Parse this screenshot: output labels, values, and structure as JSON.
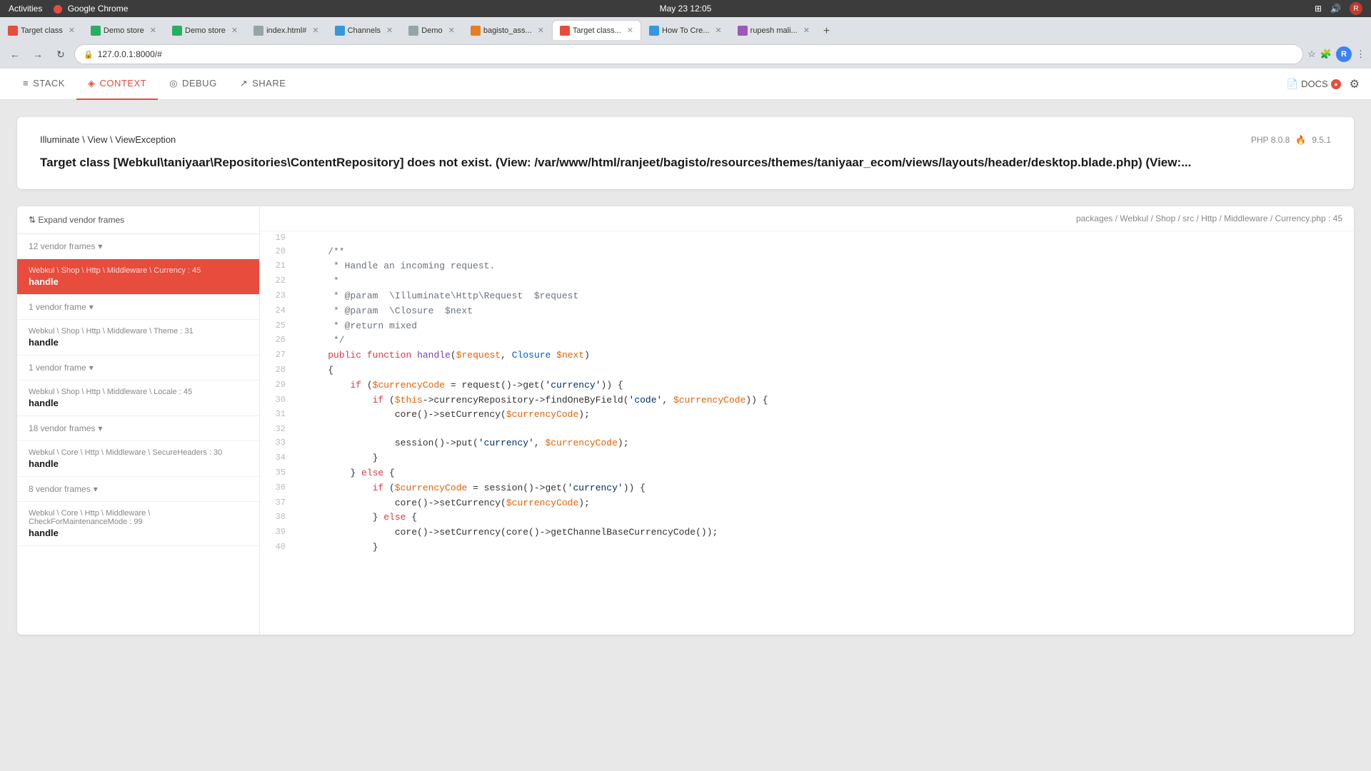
{
  "os": {
    "left_items": [
      "Activities",
      "Google Chrome"
    ],
    "datetime": "May 23  12:05"
  },
  "browser": {
    "url": "127.0.0.1:8000/#",
    "tabs": [
      {
        "label": "Target class",
        "active": false,
        "fav": "red"
      },
      {
        "label": "Demo store",
        "active": false,
        "fav": "green"
      },
      {
        "label": "Demo store",
        "active": false,
        "fav": "green"
      },
      {
        "label": "index.html#",
        "active": false,
        "fav": "gray"
      },
      {
        "label": "Channels",
        "active": false,
        "fav": "blue"
      },
      {
        "label": "Demo",
        "active": false,
        "fav": "gray"
      },
      {
        "label": "bagisto_ass...",
        "active": false,
        "fav": "orange"
      },
      {
        "label": "Target class...",
        "active": true,
        "fav": "red"
      },
      {
        "label": "How To Cre...",
        "active": false,
        "fav": "blue"
      },
      {
        "label": "rupesh mali...",
        "active": false,
        "fav": "purple"
      }
    ]
  },
  "ignition": {
    "nav_items": [
      {
        "label": "STACK",
        "active": false,
        "icon": "≡"
      },
      {
        "label": "CONTEXT",
        "active": true,
        "icon": "◈"
      },
      {
        "label": "DEBUG",
        "active": false,
        "icon": "◎"
      },
      {
        "label": "SHARE",
        "active": false,
        "icon": "↗"
      }
    ],
    "docs_label": "DOCS",
    "docs_count": "●",
    "gear_icon": "⚙"
  },
  "error": {
    "exception": "Illuminate \\ View \\ ViewException",
    "php_version": "PHP 8.0.8",
    "ignition_version": "9.5.1",
    "message": "Target class [Webkul\\taniyaar\\Repositories\\ContentRepository] does not exist. (View: /var/www/html/ranjeet/bagisto/resources/themes/taniyaar_ecom/views/layouts/header/desktop.blade.php) (View:..."
  },
  "stack": {
    "expand_btn": "⇅ Expand vendor frames",
    "frames": [
      {
        "type": "vendor-count",
        "label": "12 vendor frames",
        "has_toggle": true
      },
      {
        "type": "frame",
        "active": true,
        "path": "Webkul \\ Shop \\ Http \\ Middleware \\ Currency : 45",
        "method": "handle"
      },
      {
        "type": "vendor-count",
        "label": "1 vendor frame",
        "has_toggle": true
      },
      {
        "type": "frame",
        "active": false,
        "path": "Webkul \\ Shop \\ Http \\ Middleware \\ Theme : 31",
        "method": "handle"
      },
      {
        "type": "vendor-count",
        "label": "1 vendor frame",
        "has_toggle": true
      },
      {
        "type": "frame",
        "active": false,
        "path": "Webkul \\ Shop \\ Http \\ Middleware \\ Locale : 45",
        "method": "handle"
      },
      {
        "type": "vendor-count",
        "label": "18 vendor frames",
        "has_toggle": true
      },
      {
        "type": "frame",
        "active": false,
        "path": "Webkul \\ Core \\ Http \\ Middleware \\ SecureHeaders : 30",
        "method": "handle"
      },
      {
        "type": "vendor-count",
        "label": "8 vendor frames",
        "has_toggle": true
      },
      {
        "type": "frame",
        "active": false,
        "path": "Webkul \\ Core \\ Http \\ Middleware \\ CheckForMaintenanceMode : 99",
        "method": "handle"
      }
    ]
  },
  "code": {
    "file_path": "packages / Webkul / Shop / src / Http / Middleware / Currency.php : 45",
    "lines": [
      {
        "num": 19,
        "tokens": []
      },
      {
        "num": 20,
        "tokens": [
          {
            "t": "comment",
            "v": "    /**"
          }
        ]
      },
      {
        "num": 21,
        "tokens": [
          {
            "t": "comment",
            "v": "     * Handle an incoming request."
          }
        ]
      },
      {
        "num": 22,
        "tokens": [
          {
            "t": "comment",
            "v": "     *"
          }
        ]
      },
      {
        "num": 23,
        "tokens": [
          {
            "t": "comment",
            "v": "     * @param  \\Illuminate\\Http\\Request  $request"
          }
        ]
      },
      {
        "num": 24,
        "tokens": [
          {
            "t": "comment",
            "v": "     * @param  \\Closure  $next"
          }
        ]
      },
      {
        "num": 25,
        "tokens": [
          {
            "t": "comment",
            "v": "     * @return mixed"
          }
        ]
      },
      {
        "num": 26,
        "tokens": [
          {
            "t": "comment",
            "v": "     */"
          }
        ]
      },
      {
        "num": 27,
        "tokens": [
          {
            "t": "kw",
            "v": "    public"
          },
          {
            "t": "plain",
            "v": " "
          },
          {
            "t": "kw",
            "v": "function"
          },
          {
            "t": "plain",
            "v": " "
          },
          {
            "t": "fn",
            "v": "handle"
          },
          {
            "t": "plain",
            "v": "("
          },
          {
            "t": "var",
            "v": "$request"
          },
          {
            "t": "plain",
            "v": ", "
          },
          {
            "t": "cls",
            "v": "Closure"
          },
          {
            "t": "plain",
            "v": " "
          },
          {
            "t": "var",
            "v": "$next"
          },
          {
            "t": "plain",
            "v": ")"
          }
        ]
      },
      {
        "num": 28,
        "tokens": [
          {
            "t": "plain",
            "v": "    {"
          }
        ]
      },
      {
        "num": 29,
        "tokens": [
          {
            "t": "plain",
            "v": "        "
          },
          {
            "t": "kw",
            "v": "if"
          },
          {
            "t": "plain",
            "v": " ("
          },
          {
            "t": "var",
            "v": "$currencyCode"
          },
          {
            "t": "plain",
            "v": " = request()->get("
          },
          {
            "t": "str",
            "v": "'currency'"
          },
          {
            "t": "plain",
            "v": ")) {"
          }
        ]
      },
      {
        "num": 30,
        "tokens": [
          {
            "t": "plain",
            "v": "            "
          },
          {
            "t": "kw",
            "v": "if"
          },
          {
            "t": "plain",
            "v": " ("
          },
          {
            "t": "var",
            "v": "$this"
          },
          {
            "t": "plain",
            "v": "->currencyRepository->findOneByField("
          },
          {
            "t": "str",
            "v": "'code'"
          },
          {
            "t": "plain",
            "v": ", "
          },
          {
            "t": "var",
            "v": "$currencyCode"
          },
          {
            "t": "plain",
            "v": ")) {"
          }
        ]
      },
      {
        "num": 31,
        "tokens": [
          {
            "t": "plain",
            "v": "                core()->setCurrency("
          },
          {
            "t": "var",
            "v": "$currencyCode"
          },
          {
            "t": "plain",
            "v": ");"
          }
        ]
      },
      {
        "num": 32,
        "tokens": []
      },
      {
        "num": 33,
        "tokens": [
          {
            "t": "plain",
            "v": "                session()->put("
          },
          {
            "t": "str",
            "v": "'currency'"
          },
          {
            "t": "plain",
            "v": ", "
          },
          {
            "t": "var",
            "v": "$currencyCode"
          },
          {
            "t": "plain",
            "v": ");"
          }
        ]
      },
      {
        "num": 34,
        "tokens": [
          {
            "t": "plain",
            "v": "            }"
          }
        ]
      },
      {
        "num": 35,
        "tokens": [
          {
            "t": "plain",
            "v": "        } "
          },
          {
            "t": "kw",
            "v": "else"
          },
          {
            "t": "plain",
            "v": " {"
          }
        ]
      },
      {
        "num": 36,
        "tokens": [
          {
            "t": "plain",
            "v": "            "
          },
          {
            "t": "kw",
            "v": "if"
          },
          {
            "t": "plain",
            "v": " ("
          },
          {
            "t": "var",
            "v": "$currencyCode"
          },
          {
            "t": "plain",
            "v": " = session()->get("
          },
          {
            "t": "str",
            "v": "'currency'"
          },
          {
            "t": "plain",
            "v": ")) {"
          }
        ]
      },
      {
        "num": 37,
        "tokens": [
          {
            "t": "plain",
            "v": "                core()->setCurrency("
          },
          {
            "t": "var",
            "v": "$currencyCode"
          },
          {
            "t": "plain",
            "v": ");"
          }
        ]
      },
      {
        "num": 38,
        "tokens": [
          {
            "t": "plain",
            "v": "            } "
          },
          {
            "t": "kw",
            "v": "else"
          },
          {
            "t": "plain",
            "v": " {"
          }
        ]
      },
      {
        "num": 39,
        "tokens": [
          {
            "t": "plain",
            "v": "                core()->setCurrency(core()->getChannelBaseCurrencyCode());"
          }
        ]
      },
      {
        "num": 40,
        "tokens": [
          {
            "t": "plain",
            "v": "            }"
          }
        ]
      }
    ]
  },
  "colors": {
    "active_tab_bg": "#fff",
    "inactive_tab_bg": "#dee1e6",
    "accent": "#e74c3c",
    "toolbar_bg": "#fff"
  }
}
